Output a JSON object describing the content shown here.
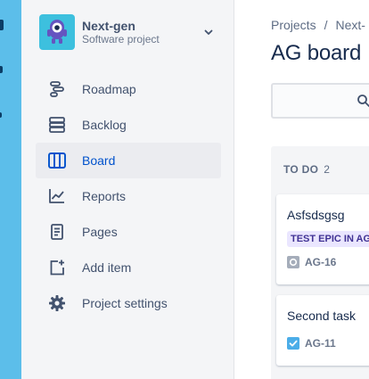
{
  "sidebar": {
    "project": {
      "name": "Next-gen",
      "type": "Software project",
      "avatar_color": "#3dc0de"
    },
    "items": [
      {
        "label": "Roadmap",
        "icon": "roadmap-icon",
        "active": false
      },
      {
        "label": "Backlog",
        "icon": "backlog-icon",
        "active": false
      },
      {
        "label": "Board",
        "icon": "board-icon",
        "active": true
      },
      {
        "label": "Reports",
        "icon": "reports-icon",
        "active": false
      },
      {
        "label": "Pages",
        "icon": "pages-icon",
        "active": false
      },
      {
        "label": "Add item",
        "icon": "add-item-icon",
        "active": false
      },
      {
        "label": "Project settings",
        "icon": "gear-icon",
        "active": false
      }
    ]
  },
  "main": {
    "breadcrumb": [
      "Projects",
      "/",
      "Next-"
    ],
    "title": "AG board",
    "board": {
      "columns": [
        {
          "title": "TO DO",
          "count": "2",
          "cards": [
            {
              "summary": "Asfsdsgsg",
              "epic": "TEST EPIC IN AG",
              "issue_type": "story",
              "key": "AG-16"
            },
            {
              "summary": "Second task",
              "issue_type": "task",
              "key": "AG-11"
            }
          ]
        }
      ]
    }
  },
  "colors": {
    "global_nav": "#5cbeea",
    "sidebar_bg": "#f4f5f7",
    "accent": "#0052cc",
    "epic_bg": "#eae6ff",
    "epic_text": "#403294",
    "task_icon": "#4bade8"
  }
}
